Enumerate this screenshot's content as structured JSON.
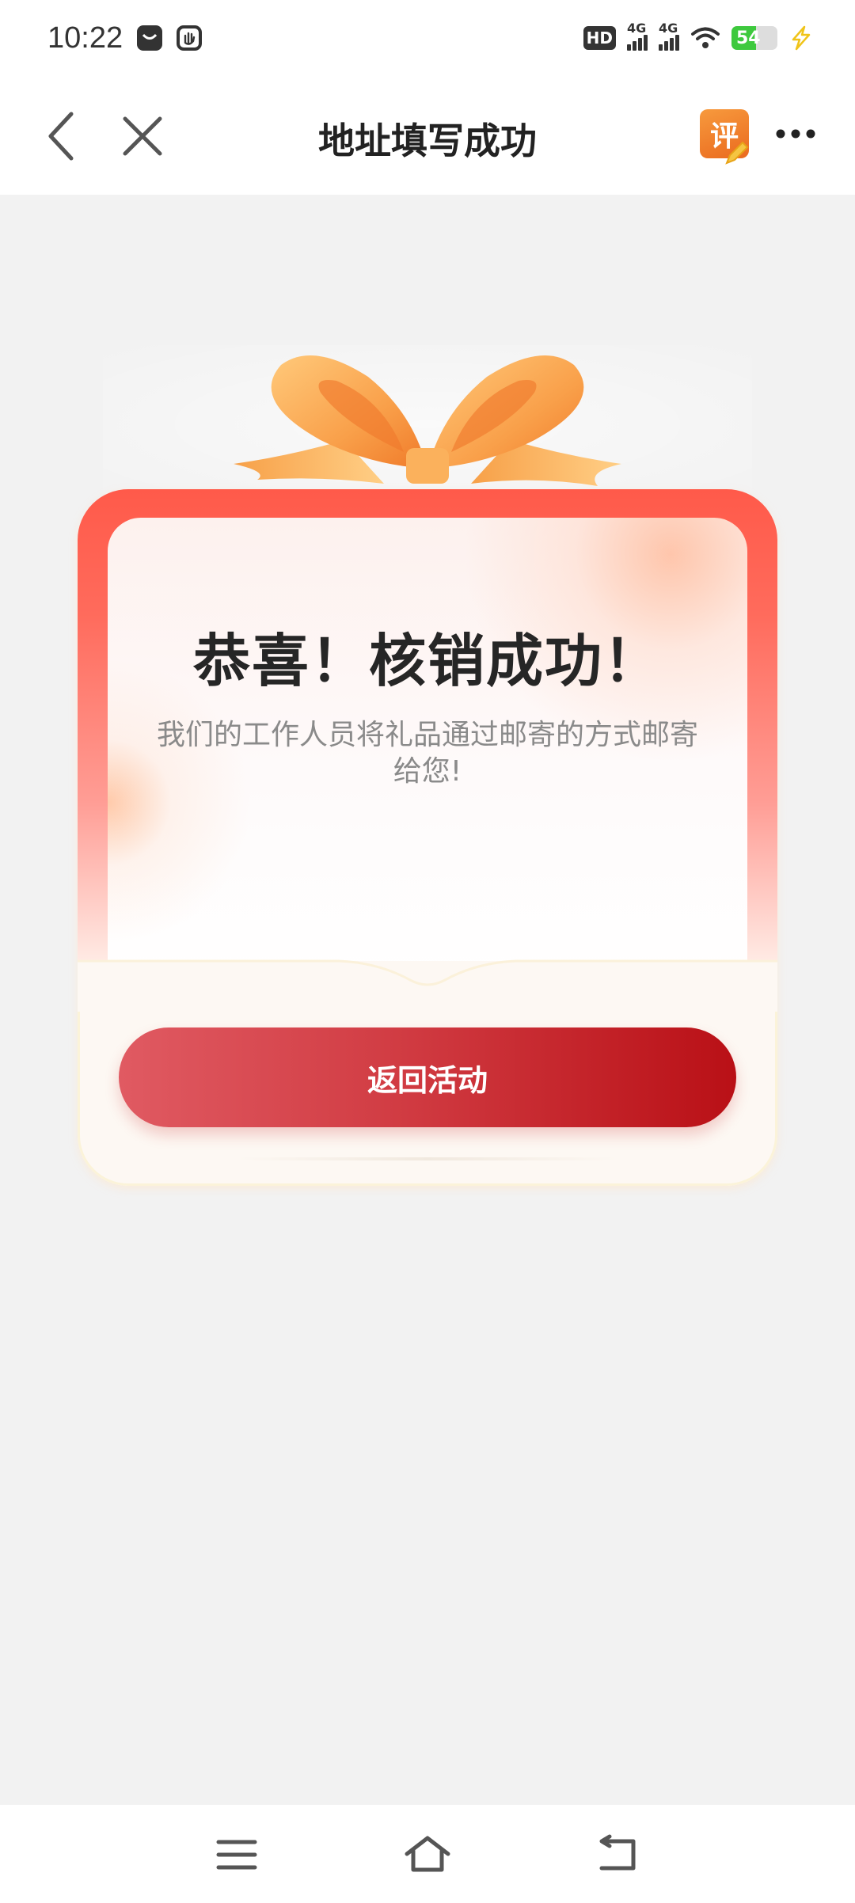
{
  "status_bar": {
    "time": "10:22",
    "hd_label": "HD",
    "network_1": "4G",
    "network_2": "4G",
    "battery": "54"
  },
  "header": {
    "title": "地址填写成功",
    "review_icon_label": "评"
  },
  "card": {
    "title": "恭喜！核销成功！",
    "message": "我们的工作人员将礼品通过邮寄的方式邮寄给您!",
    "button_label": "返回活动"
  },
  "colors": {
    "accent_red": "#d13c43",
    "card_top_red": "#ff5a4a",
    "ribbon_orange": "#f6a049",
    "battery_green": "#3ec93e"
  },
  "icons": {
    "back": "chevron-left-icon",
    "close": "close-icon",
    "review": "review-edit-icon",
    "more": "more-icon",
    "menu": "menu-icon",
    "home": "home-icon",
    "system_back": "back-icon"
  }
}
